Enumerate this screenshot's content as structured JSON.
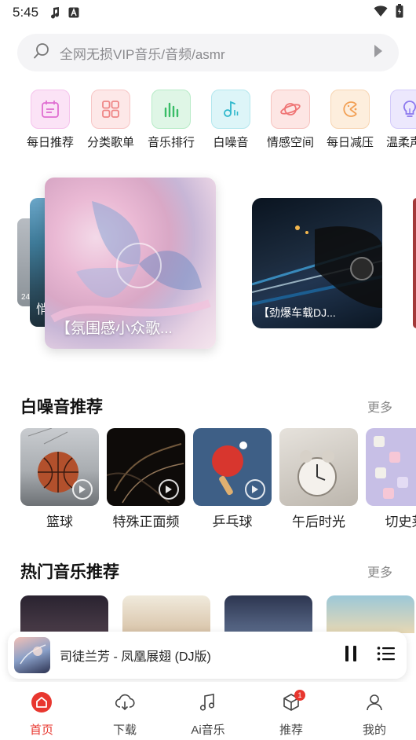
{
  "status_bar": {
    "time": "5:45",
    "icons": [
      "music-note-icon",
      "notification-a-icon",
      "wifi-icon",
      "battery-icon"
    ]
  },
  "search": {
    "placeholder": "全网无损VIP音乐/音频/asmr"
  },
  "categories": [
    {
      "label": "每日推荐",
      "icon": "calendar-icon",
      "color": "#e86fd6"
    },
    {
      "label": "分类歌单",
      "icon": "grid-icon",
      "color": "#f08a8a"
    },
    {
      "label": "音乐排行",
      "icon": "bar-chart-icon",
      "color": "#3cbf6a"
    },
    {
      "label": "白噪音",
      "icon": "music-note-icon",
      "color": "#30bccf"
    },
    {
      "label": "情感空间",
      "icon": "planet-icon",
      "color": "#f07878"
    },
    {
      "label": "每日减压",
      "icon": "pacman-icon",
      "color": "#f3a259"
    },
    {
      "label": "温柔声音",
      "icon": "bulb-icon",
      "color": "#8f7bf0"
    }
  ],
  "carousel": {
    "main_label": "【氛围感小众歌...",
    "right_label": "【劲爆车载DJ...",
    "left_label": "悄",
    "left_count": "24"
  },
  "white_noise": {
    "title": "白噪音推荐",
    "more": "更多",
    "items": [
      {
        "label": "篮球"
      },
      {
        "label": "特殊正面频"
      },
      {
        "label": "乒乓球"
      },
      {
        "label": "午后时光"
      },
      {
        "label": "切史莱"
      }
    ]
  },
  "hot_music": {
    "title": "热门音乐推荐",
    "more": "更多"
  },
  "player": {
    "title": "司徒兰芳 - 凤凰展翅 (DJ版)"
  },
  "tabs": [
    {
      "label": "首页",
      "active": true
    },
    {
      "label": "下载"
    },
    {
      "label": "Ai音乐"
    },
    {
      "label": "推荐",
      "badge": "1"
    },
    {
      "label": "我的"
    }
  ],
  "colors": {
    "accent": "#e8372f"
  }
}
